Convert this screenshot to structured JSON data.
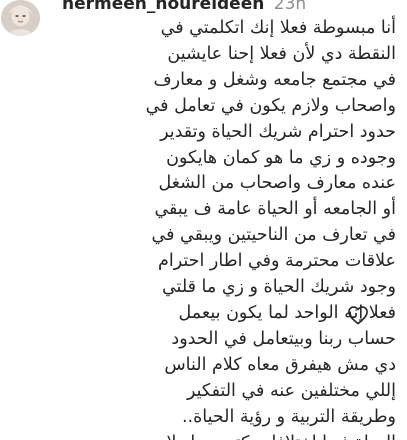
{
  "comment": {
    "username": "nermeen_noureldeen",
    "timestamp": "23h",
    "avatar_icon": "profile-avatar-icon",
    "like_icon": "heart-outline-icon",
    "lines": [
      "أنا مبسوطة فعلا إنك اتكلمتي في",
      "النقطة دي لأن فعلا إحنا عايشين",
      "في مجتمع جامعه وشغل و معارف",
      "واصحاب ولازم يكون في تعامل في",
      "حدود احترام شريك الحياة وتقدير",
      "وجوده و زي ما هو كمان هايكون",
      "عنده معارف واصحاب من الشغل",
      "أو الجامعه أو الحياة عامة ف يبقي",
      "في تعارف من الناحيتين ويبقي في",
      "علاقات محترمة وفي اطار احترام",
      "وجود شريك الحياة و زي ما قلتي",
      "فعلا إنه الواحد لما يكون بيعمل",
      "حساب ربنا وبيتعامل في الحدود",
      "دي مش هيفرق معاه كلام الناس",
      "إللي مختلفين عنه في التفكير",
      "وطريقة التربية و رؤية الحياة..",
      "الحياة فيها اختلافات كتير جدا ولازم"
    ]
  },
  "colors": {
    "text": "#262626",
    "secondary_text": "#8e8e8e",
    "background": "#ffffff"
  }
}
